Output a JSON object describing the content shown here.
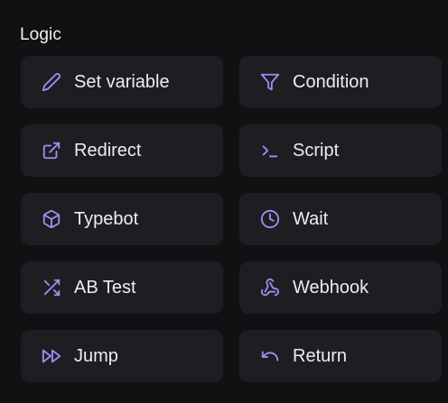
{
  "section": {
    "title": "Logic"
  },
  "blocks": [
    {
      "label": "Set variable",
      "icon": "pencil-icon"
    },
    {
      "label": "Condition",
      "icon": "filter-icon"
    },
    {
      "label": "Redirect",
      "icon": "external-link-icon"
    },
    {
      "label": "Script",
      "icon": "terminal-icon"
    },
    {
      "label": "Typebot",
      "icon": "cube-icon"
    },
    {
      "label": "Wait",
      "icon": "clock-icon"
    },
    {
      "label": "AB Test",
      "icon": "shuffle-icon"
    },
    {
      "label": "Webhook",
      "icon": "webhook-icon"
    },
    {
      "label": "Jump",
      "icon": "fast-forward-icon"
    },
    {
      "label": "Return",
      "icon": "undo-icon"
    }
  ],
  "colors": {
    "background": "#111113",
    "block_background": "#1e1e22",
    "icon_accent": "#a38bf2",
    "text": "#ededf0"
  }
}
